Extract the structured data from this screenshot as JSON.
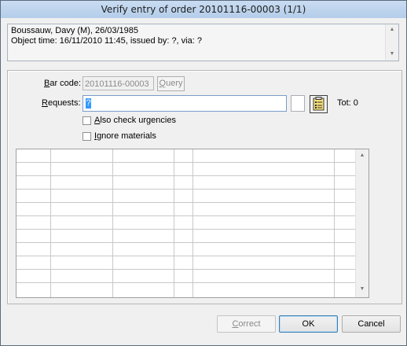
{
  "window": {
    "title": "Verify entry of order 20101116-00003 (1/1)"
  },
  "info": {
    "line1": "Boussauw, Davy (M), 26/03/1985",
    "line2": "Object time: 16/11/2010 11:45, issued by: ?, via: ?"
  },
  "form": {
    "barcode_label_u": "B",
    "barcode_label_rest": "ar code:",
    "barcode_value": "20101116-00003",
    "query_label_u": "Q",
    "query_label_rest": "uery",
    "requests_label_u": "R",
    "requests_label_rest": "equests:",
    "requests_value": "?",
    "total_text": "Tot: 0",
    "also_check_u": "A",
    "also_check_rest": "lso check urgencies",
    "also_check_checked": false,
    "ignore_u": "I",
    "ignore_rest": "gnore materials",
    "ignore_checked": false
  },
  "grid": {
    "rows": 11,
    "columns": 7
  },
  "buttons": {
    "correct_u": "C",
    "correct_rest": "orrect",
    "ok": "OK",
    "cancel": "Cancel"
  },
  "icons": {
    "requests_picker": "clipboard-list-icon"
  }
}
